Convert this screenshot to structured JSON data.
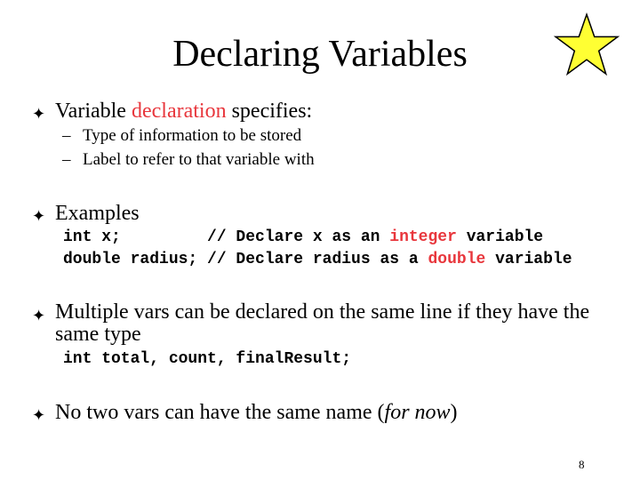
{
  "title": "Declaring Variables",
  "bullet_symbol": "✦",
  "colors": {
    "highlight": "#e8363c",
    "star_fill": "#ffff33"
  },
  "bullets": [
    {
      "pre": "Variable ",
      "highlight": "declaration",
      "post": " specifies:",
      "subitems": [
        "Type of information to be stored",
        "Label to refer to that variable with"
      ]
    },
    {
      "text": "Examples",
      "code_lines": [
        {
          "code": "int x;         ",
          "comment_pre": "// Declare x as an ",
          "keyword": "integer",
          "comment_post": " variable"
        },
        {
          "code": "double radius; ",
          "comment_pre": "// Declare radius as a ",
          "keyword": "double",
          "comment_post": " variable"
        }
      ]
    },
    {
      "text": "Multiple vars can be declared on the same line if they have the same type",
      "code": "int total, count, finalResult;"
    },
    {
      "pre": "No two vars can have the same name (",
      "italic": "for now",
      "post": ")"
    }
  ],
  "sub_dash": "–",
  "page_number": "8"
}
